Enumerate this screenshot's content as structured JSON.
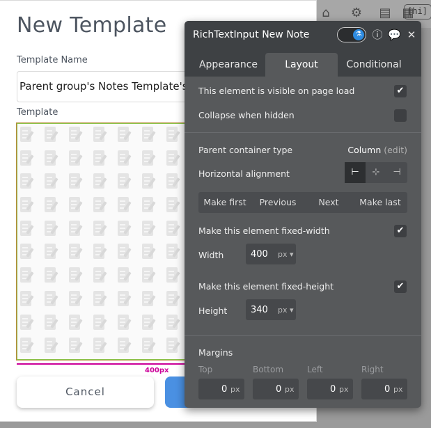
{
  "background": {
    "tool_icons": [
      "home-icon",
      "gear-icon",
      "document-icon",
      "grid-icon"
    ],
    "hint_text": "[hi]"
  },
  "popup": {
    "title": "New Template",
    "template_name_label": "Template Name",
    "template_name_value": "Parent group's Notes Template's N",
    "template_label": "Template",
    "width_ruler_label": "400px",
    "cancel_label": "Cancel"
  },
  "panel": {
    "title": "RichTextInput New Note",
    "toggle_icon": "flask-icon",
    "tabs": [
      {
        "label": "Appearance"
      },
      {
        "label": "Layout",
        "active": true
      },
      {
        "label": "Conditional"
      }
    ],
    "visible_on_load": {
      "label": "This element is visible on page load",
      "checked": true
    },
    "collapse_when_hidden": {
      "label": "Collapse when hidden",
      "checked": false
    },
    "parent_container": {
      "label": "Parent container type",
      "value": "Column",
      "edit": "(edit)"
    },
    "horizontal_alignment": {
      "label": "Horizontal alignment",
      "selected": "left"
    },
    "order_buttons": [
      "Make first",
      "Previous",
      "Next",
      "Make last"
    ],
    "fixed_width": {
      "label": "Make this element fixed-width",
      "checked": true
    },
    "width": {
      "label": "Width",
      "value": "400",
      "unit": "px"
    },
    "fixed_height": {
      "label": "Make this element fixed-height",
      "checked": true
    },
    "height": {
      "label": "Height",
      "value": "340",
      "unit": "px"
    },
    "margins": {
      "label": "Margins",
      "fields": [
        {
          "label": "Top",
          "value": "0",
          "unit": "px"
        },
        {
          "label": "Bottom",
          "value": "0",
          "unit": "px"
        },
        {
          "label": "Left",
          "value": "0",
          "unit": "px"
        },
        {
          "label": "Right",
          "value": "0",
          "unit": "px"
        }
      ]
    }
  }
}
